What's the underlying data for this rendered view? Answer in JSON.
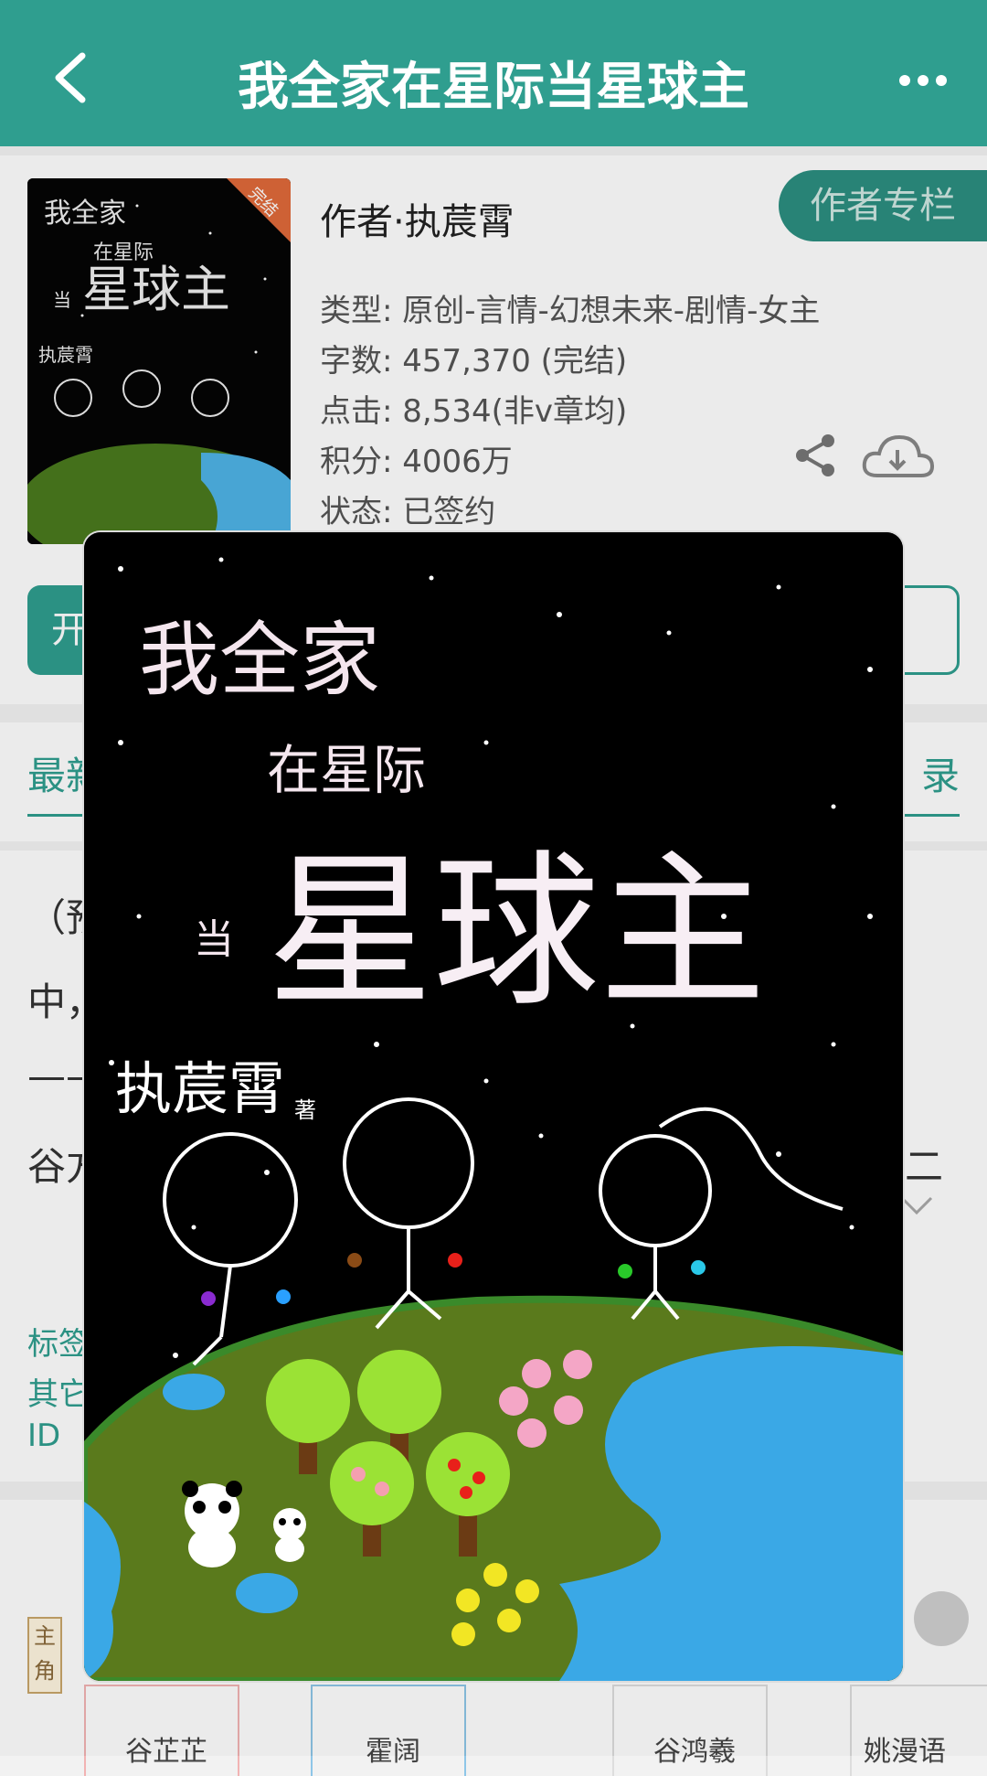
{
  "topbar": {
    "title": "我全家在星际当星球主"
  },
  "book": {
    "author": "作者·执莀霄",
    "author_column_label": "作者专栏",
    "type": "类型: 原创-言情-幻想未来-剧情-女主",
    "word_count": "字数: 457,370 (完结)",
    "clicks": "点击: 8,534(非v章均)",
    "score": "积分: 4006万",
    "status": "状态: 已签约",
    "badge": "完结"
  },
  "actions": {
    "start_partial": "开",
    "catalog_partial": "录"
  },
  "tabs": {
    "latest_partial": "最新",
    "catalog_partial": "录"
  },
  "intro_fragments": {
    "line1": "（预",
    "line2": "中，",
    "line3": "——",
    "line4": "谷方",
    "line4_right": "二"
  },
  "tags_fragments": {
    "tag_label": "标签",
    "other_label": "其它",
    "id_label": "ID"
  },
  "roles": {
    "tag": "主角",
    "names": [
      "谷芷芷",
      "霍阔",
      "谷鸿羲",
      "姚漫语"
    ]
  },
  "cover": {
    "title_line1": "我全家",
    "title_line2": "在星际",
    "title_prefix": "当",
    "title_big": "星球主",
    "author": "执莀霄",
    "author_suffix": "著"
  },
  "colors": {
    "accent": "#2f9e8f",
    "cover_bg": "#000000"
  }
}
